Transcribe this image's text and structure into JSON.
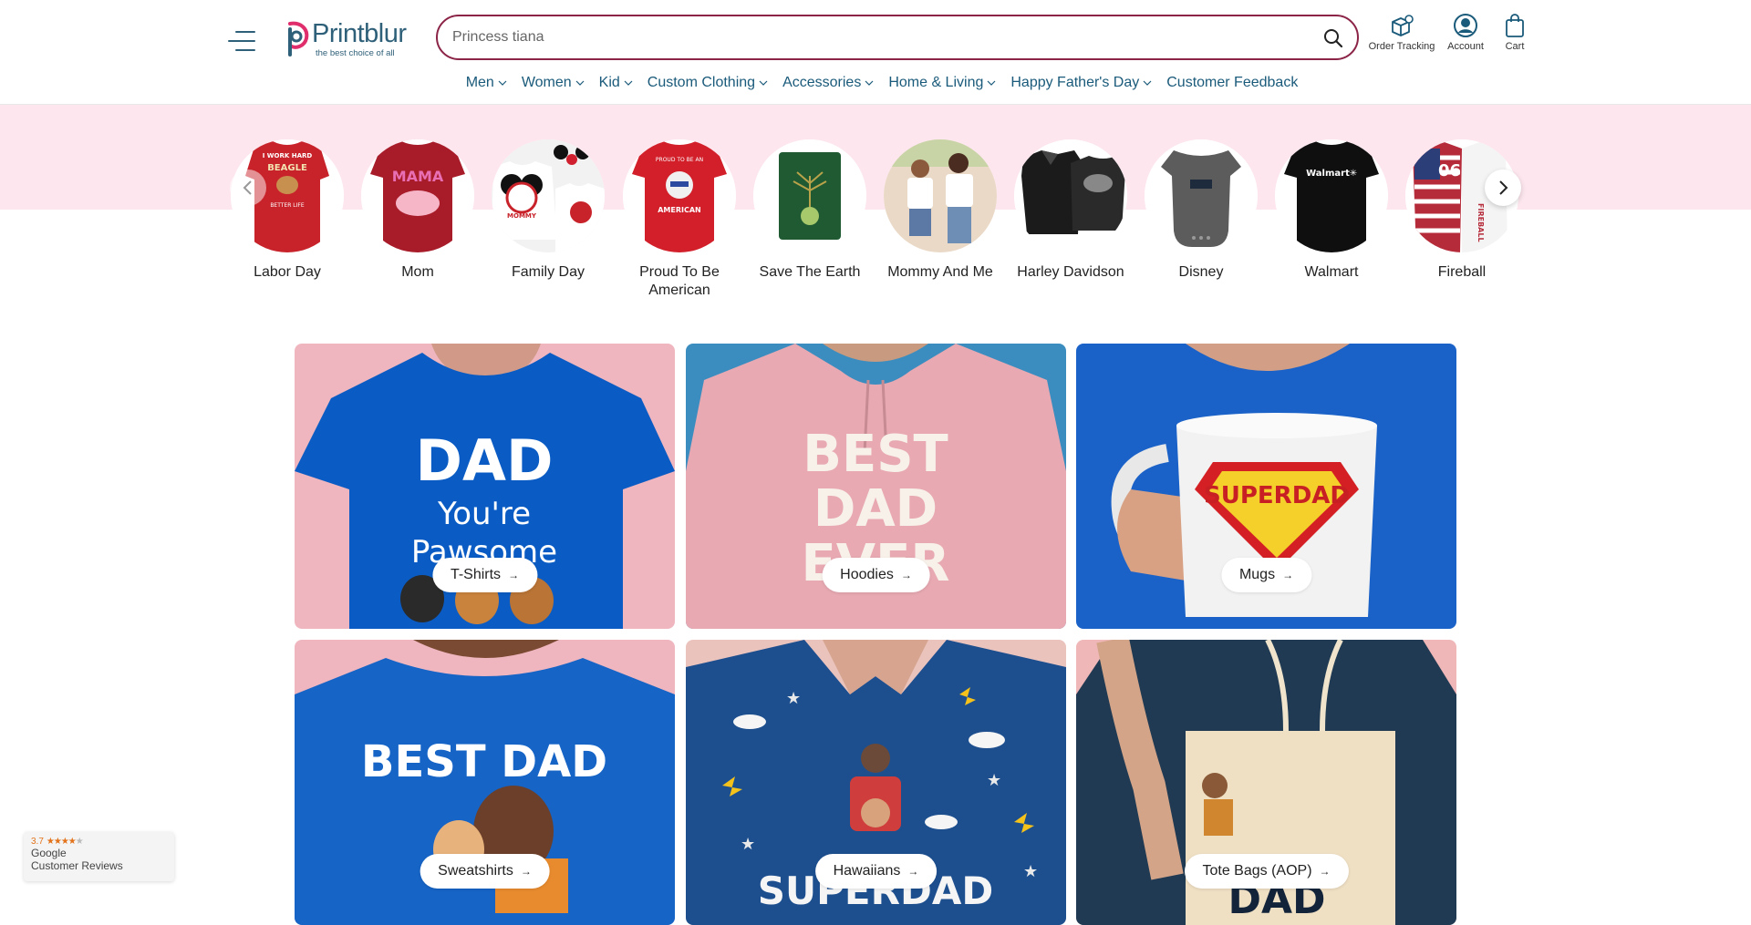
{
  "header": {
    "logo": {
      "name": "Printblur",
      "tagline": "the best choice of all"
    },
    "search": {
      "placeholder": "Princess tiana"
    },
    "icons": [
      {
        "label": "Order Tracking",
        "icon": "order-tracking-icon"
      },
      {
        "label": "Account",
        "icon": "account-icon"
      },
      {
        "label": "Cart",
        "icon": "cart-icon"
      }
    ],
    "nav": [
      {
        "label": "Men",
        "dropdown": true
      },
      {
        "label": "Women",
        "dropdown": true
      },
      {
        "label": "Kid",
        "dropdown": true
      },
      {
        "label": "Custom Clothing",
        "dropdown": true
      },
      {
        "label": "Accessories",
        "dropdown": true
      },
      {
        "label": "Home & Living",
        "dropdown": true
      },
      {
        "label": "Happy Father's Day",
        "dropdown": true
      },
      {
        "label": "Customer Feedback",
        "dropdown": false
      }
    ]
  },
  "categories": [
    {
      "label": "Labor Day"
    },
    {
      "label": "Mom"
    },
    {
      "label": "Family Day"
    },
    {
      "label": "Proud To Be American"
    },
    {
      "label": "Save The Earth"
    },
    {
      "label": "Mommy And Me"
    },
    {
      "label": "Harley Davidson"
    },
    {
      "label": "Disney"
    },
    {
      "label": "Walmart"
    },
    {
      "label": "Fireball"
    }
  ],
  "category_art_text": {
    "labor_day": [
      "I WORK HARD",
      "BEAGLE",
      "BETTER LIFE"
    ],
    "mom": "MAMA",
    "family_day": "MOMMY",
    "proud": [
      "PROUD TO BE AN",
      "AMERICAN"
    ],
    "walmart": "Walmart",
    "fireball": "FIREBALL"
  },
  "products": [
    {
      "label": "T-Shirts",
      "art": [
        "DAD",
        "You're",
        "Pawsome"
      ]
    },
    {
      "label": "Hoodies",
      "art": [
        "BEST",
        "DAD",
        "EVER"
      ]
    },
    {
      "label": "Mugs",
      "art": [
        "SUPERDAD"
      ]
    },
    {
      "label": "Sweatshirts",
      "art": [
        "BEST DAD"
      ]
    },
    {
      "label": "Hawaiians",
      "art": [
        "SUPERDAD"
      ]
    },
    {
      "label": "Tote Bags (AOP)",
      "art": [
        "DAD"
      ]
    }
  ],
  "review_badge": {
    "rating": "3.7",
    "source": "Google",
    "label": "Customer Reviews",
    "stars_filled": 4,
    "stars_total": 5
  },
  "colors": {
    "brand": "#2f6079",
    "search_border": "#8b2447",
    "nav_text": "#1a5a7a",
    "strip_bg": "#fde6ee",
    "review_star": "#e3731b"
  }
}
